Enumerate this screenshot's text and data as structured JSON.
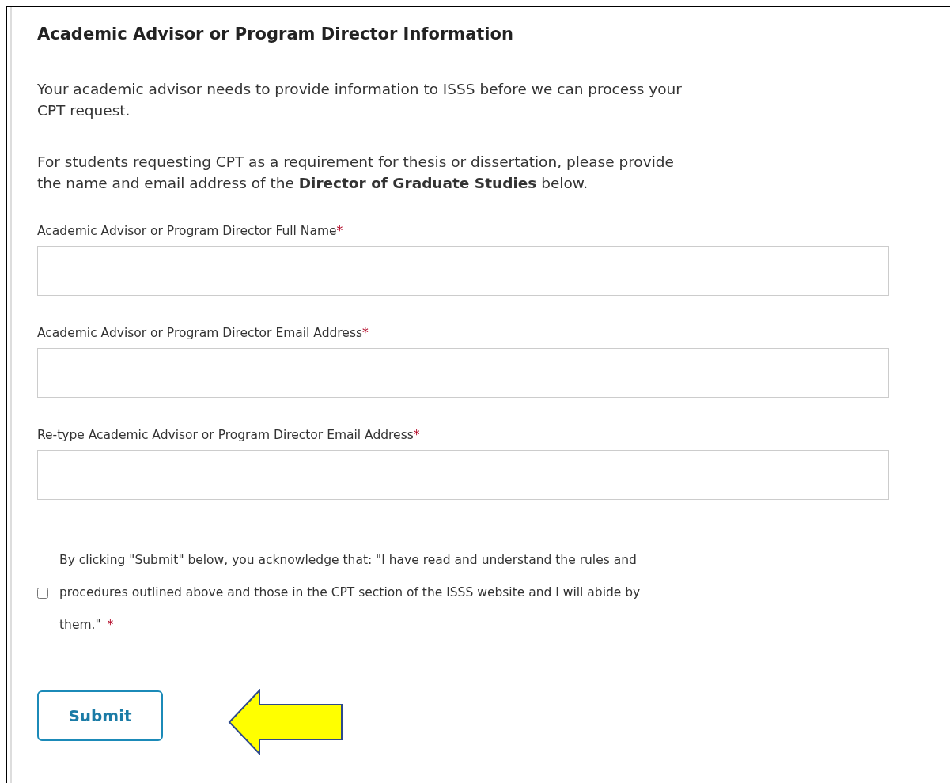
{
  "section": {
    "title": "Academic Advisor or Program Director Information",
    "paragraphs": [
      "Your academic advisor needs to provide information to ISSS before we can process your\nCPT request.",
      "For students requesting CPT as a requirement for thesis or dissertation, please provide\nthe name and email address of the **Director of Graduate Studies** below."
    ]
  },
  "fields": [
    {
      "label": "Academic Advisor or Program Director Full Name",
      "required_mark": "*"
    },
    {
      "label": "Academic Advisor or Program Director Email Address",
      "required_mark": "*"
    },
    {
      "label": "Re-type Academic Advisor or Program Director Email Address",
      "required_mark": "*"
    }
  ],
  "acknowledgement": {
    "text": "By clicking \"Submit\" below, you acknowledge that: \"I have read and understand the rules and\nprocedures outlined above and those in the CPT section of the ISSS website and I will abide by\nthem.\"",
    "required_mark": "*",
    "checked": false
  },
  "submit_button": {
    "label": "Submit"
  }
}
